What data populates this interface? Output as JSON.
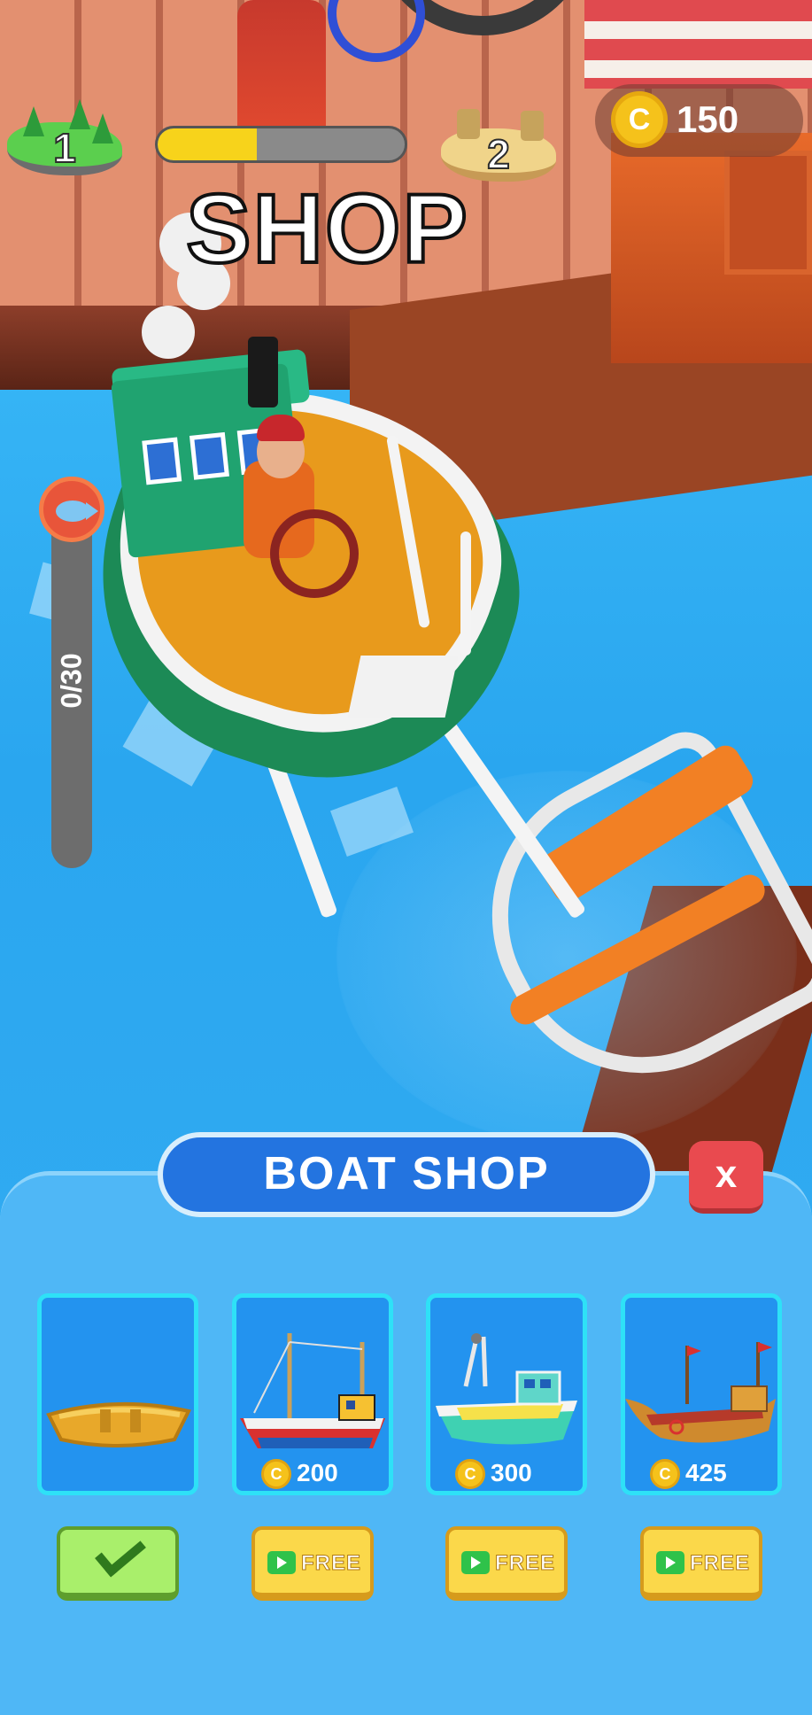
{
  "hud": {
    "current_level": "1",
    "next_level": "2",
    "level_progress": 0.4,
    "coins": "150",
    "coin_symbol": "C",
    "sign_text": "SHOP",
    "fish_counter": "0/30"
  },
  "shop": {
    "title": "BOAT SHOP",
    "close_label": "x",
    "boats": [
      {
        "name": "rowboat",
        "price": "",
        "status": "owned"
      },
      {
        "name": "sailing-trawler",
        "price": "200",
        "button_label": "FREE"
      },
      {
        "name": "fishing-boat",
        "price": "300",
        "button_label": "FREE"
      },
      {
        "name": "galleon",
        "price": "425",
        "button_label": "FREE"
      }
    ]
  },
  "colors": {
    "panel": "#4fb7f6",
    "title_pill": "#2374e0",
    "close": "#e94a4f",
    "card": "#2393ef",
    "card_border": "#2ee1f7",
    "free_button": "#fbd84a",
    "owned_button": "#a9ef6b",
    "progress_fill": "#f7d31b"
  }
}
